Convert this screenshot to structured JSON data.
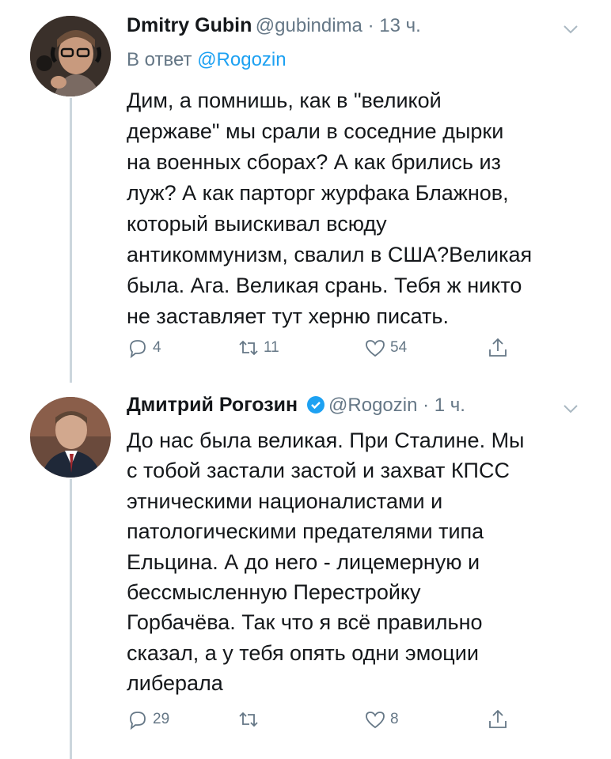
{
  "tweets": [
    {
      "author_name": "Dmitry Gubin",
      "handle_time": "@gubindima · 13 ч.",
      "reply_prefix": "В ответ",
      "reply_to": "@Rogozin",
      "text": "Дим, а помнишь, как в \"великой\nдержаве\" мы срали в соседние дырки\nна военных сборах? А как брились из\nлуж? А как парторг журфака Блажнов,\nкоторый выискивал всюду\nантикоммунизм, свалил в США?Великая\nбыла. Ага. Великая срань. Тебя ж никто\nне заставляет тут херню писать.",
      "replies": "4",
      "retweets": "11",
      "likes": "54"
    },
    {
      "author_name": "Дмитрий Рогозин",
      "handle_time": "@Rogozin · 1 ч.",
      "text": "До нас была великая. При Сталине. Мы\nс тобой застали застой и захват КПСС\nэтническими националистами и\nпатологическими предателями типа\nЕльцина. А до него - лицемерную и\nбессмысленную Перестройку\nГорбачёва. Так что я всё правильно\nсказал, а у тебя опять одни эмоции\nлиберала",
      "replies": "29",
      "retweets": "",
      "likes": "8"
    }
  ],
  "colors": {
    "accent": "#1da1f2",
    "muted": "#657786",
    "line": "#ccd6dd"
  },
  "icons": [
    "reply-icon",
    "retweet-icon",
    "like-icon",
    "share-icon",
    "chevron-down-icon",
    "verified-badge-icon"
  ]
}
